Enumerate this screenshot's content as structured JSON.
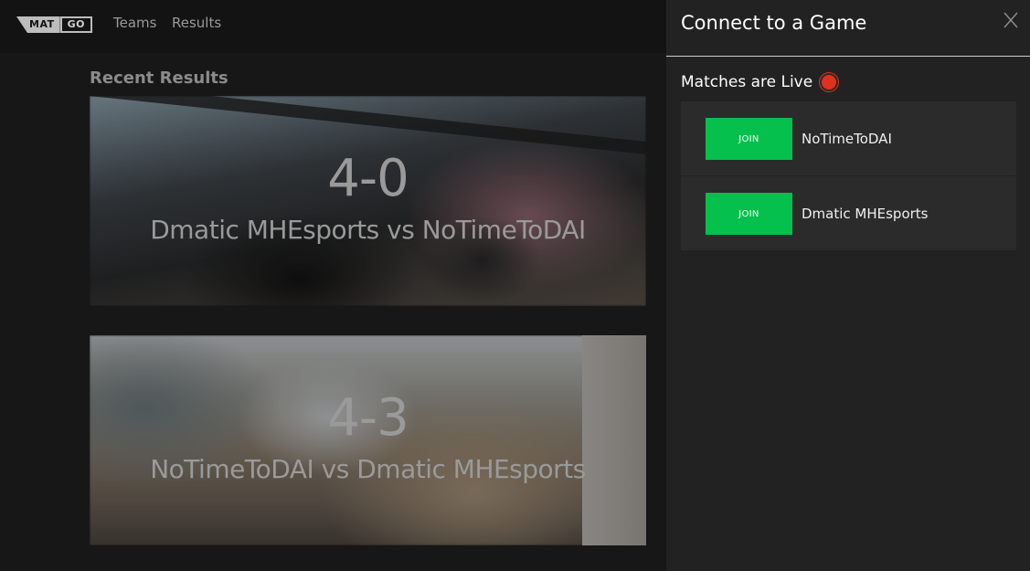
{
  "logo": {
    "part1": "MAT",
    "part2": "GO"
  },
  "nav": {
    "teams": "Teams",
    "results": "Results"
  },
  "main": {
    "section_title": "Recent Results",
    "results": [
      {
        "score": "4-0",
        "matchup": "Dmatic MHEsports vs NoTimeToDAI"
      },
      {
        "score": "4-3",
        "matchup": "NoTimeToDAI vs Dmatic MHEsports"
      }
    ]
  },
  "panel": {
    "title": "Connect to a Game",
    "close_icon": "close-icon",
    "live_label": "Matches are Live",
    "live_color": "#e0301e",
    "matches": [
      {
        "join_label": "JOIN",
        "team": "NoTimeToDAI"
      },
      {
        "join_label": "JOIN",
        "team": "Dmatic MHEsports"
      }
    ],
    "join_color": "#05c04c"
  }
}
